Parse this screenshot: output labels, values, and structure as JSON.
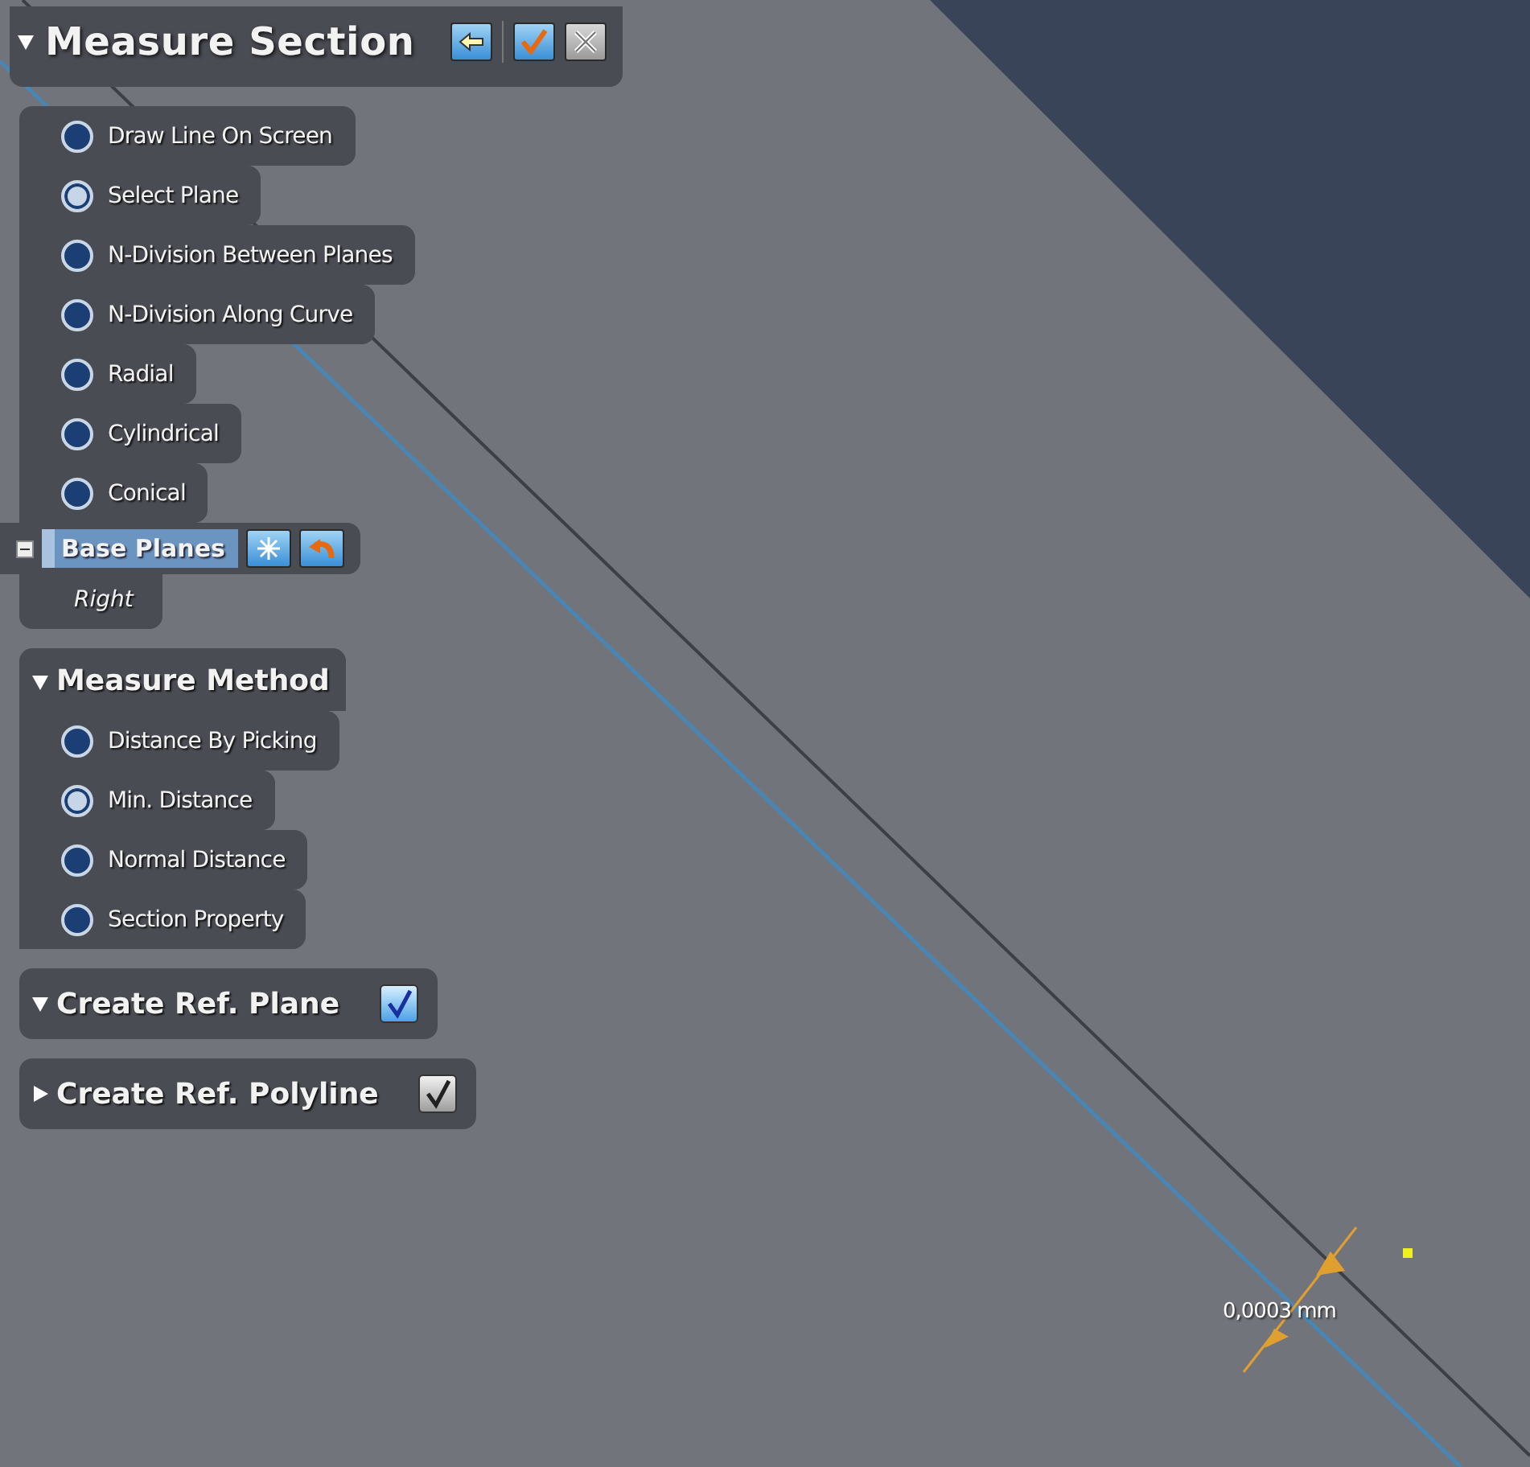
{
  "panel": {
    "title": "Measure Section",
    "expanded": true
  },
  "section_options": [
    {
      "label": "Draw Line On Screen",
      "selected": false
    },
    {
      "label": "Select Plane",
      "selected": true
    },
    {
      "label": "N-Division Between Planes",
      "selected": false
    },
    {
      "label": "N-Division Along Curve",
      "selected": false
    },
    {
      "label": "Radial",
      "selected": false
    },
    {
      "label": "Cylindrical",
      "selected": false
    },
    {
      "label": "Conical",
      "selected": false
    }
  ],
  "base_planes": {
    "label": "Base Planes",
    "expanded": true,
    "items": [
      "Right"
    ]
  },
  "measure_method": {
    "title": "Measure Method",
    "expanded": true,
    "options": [
      {
        "label": "Distance By Picking",
        "selected": false
      },
      {
        "label": "Min. Distance",
        "selected": true
      },
      {
        "label": "Normal Distance",
        "selected": false
      },
      {
        "label": "Section Property",
        "selected": false
      }
    ]
  },
  "ref_sections": [
    {
      "title": "Create Ref. Plane",
      "expanded": true,
      "checked": true,
      "disabled": false
    },
    {
      "title": "Create Ref. Polyline",
      "expanded": false,
      "checked": true,
      "disabled": true
    }
  ],
  "viewport": {
    "measurement": "0,0003 mm"
  }
}
